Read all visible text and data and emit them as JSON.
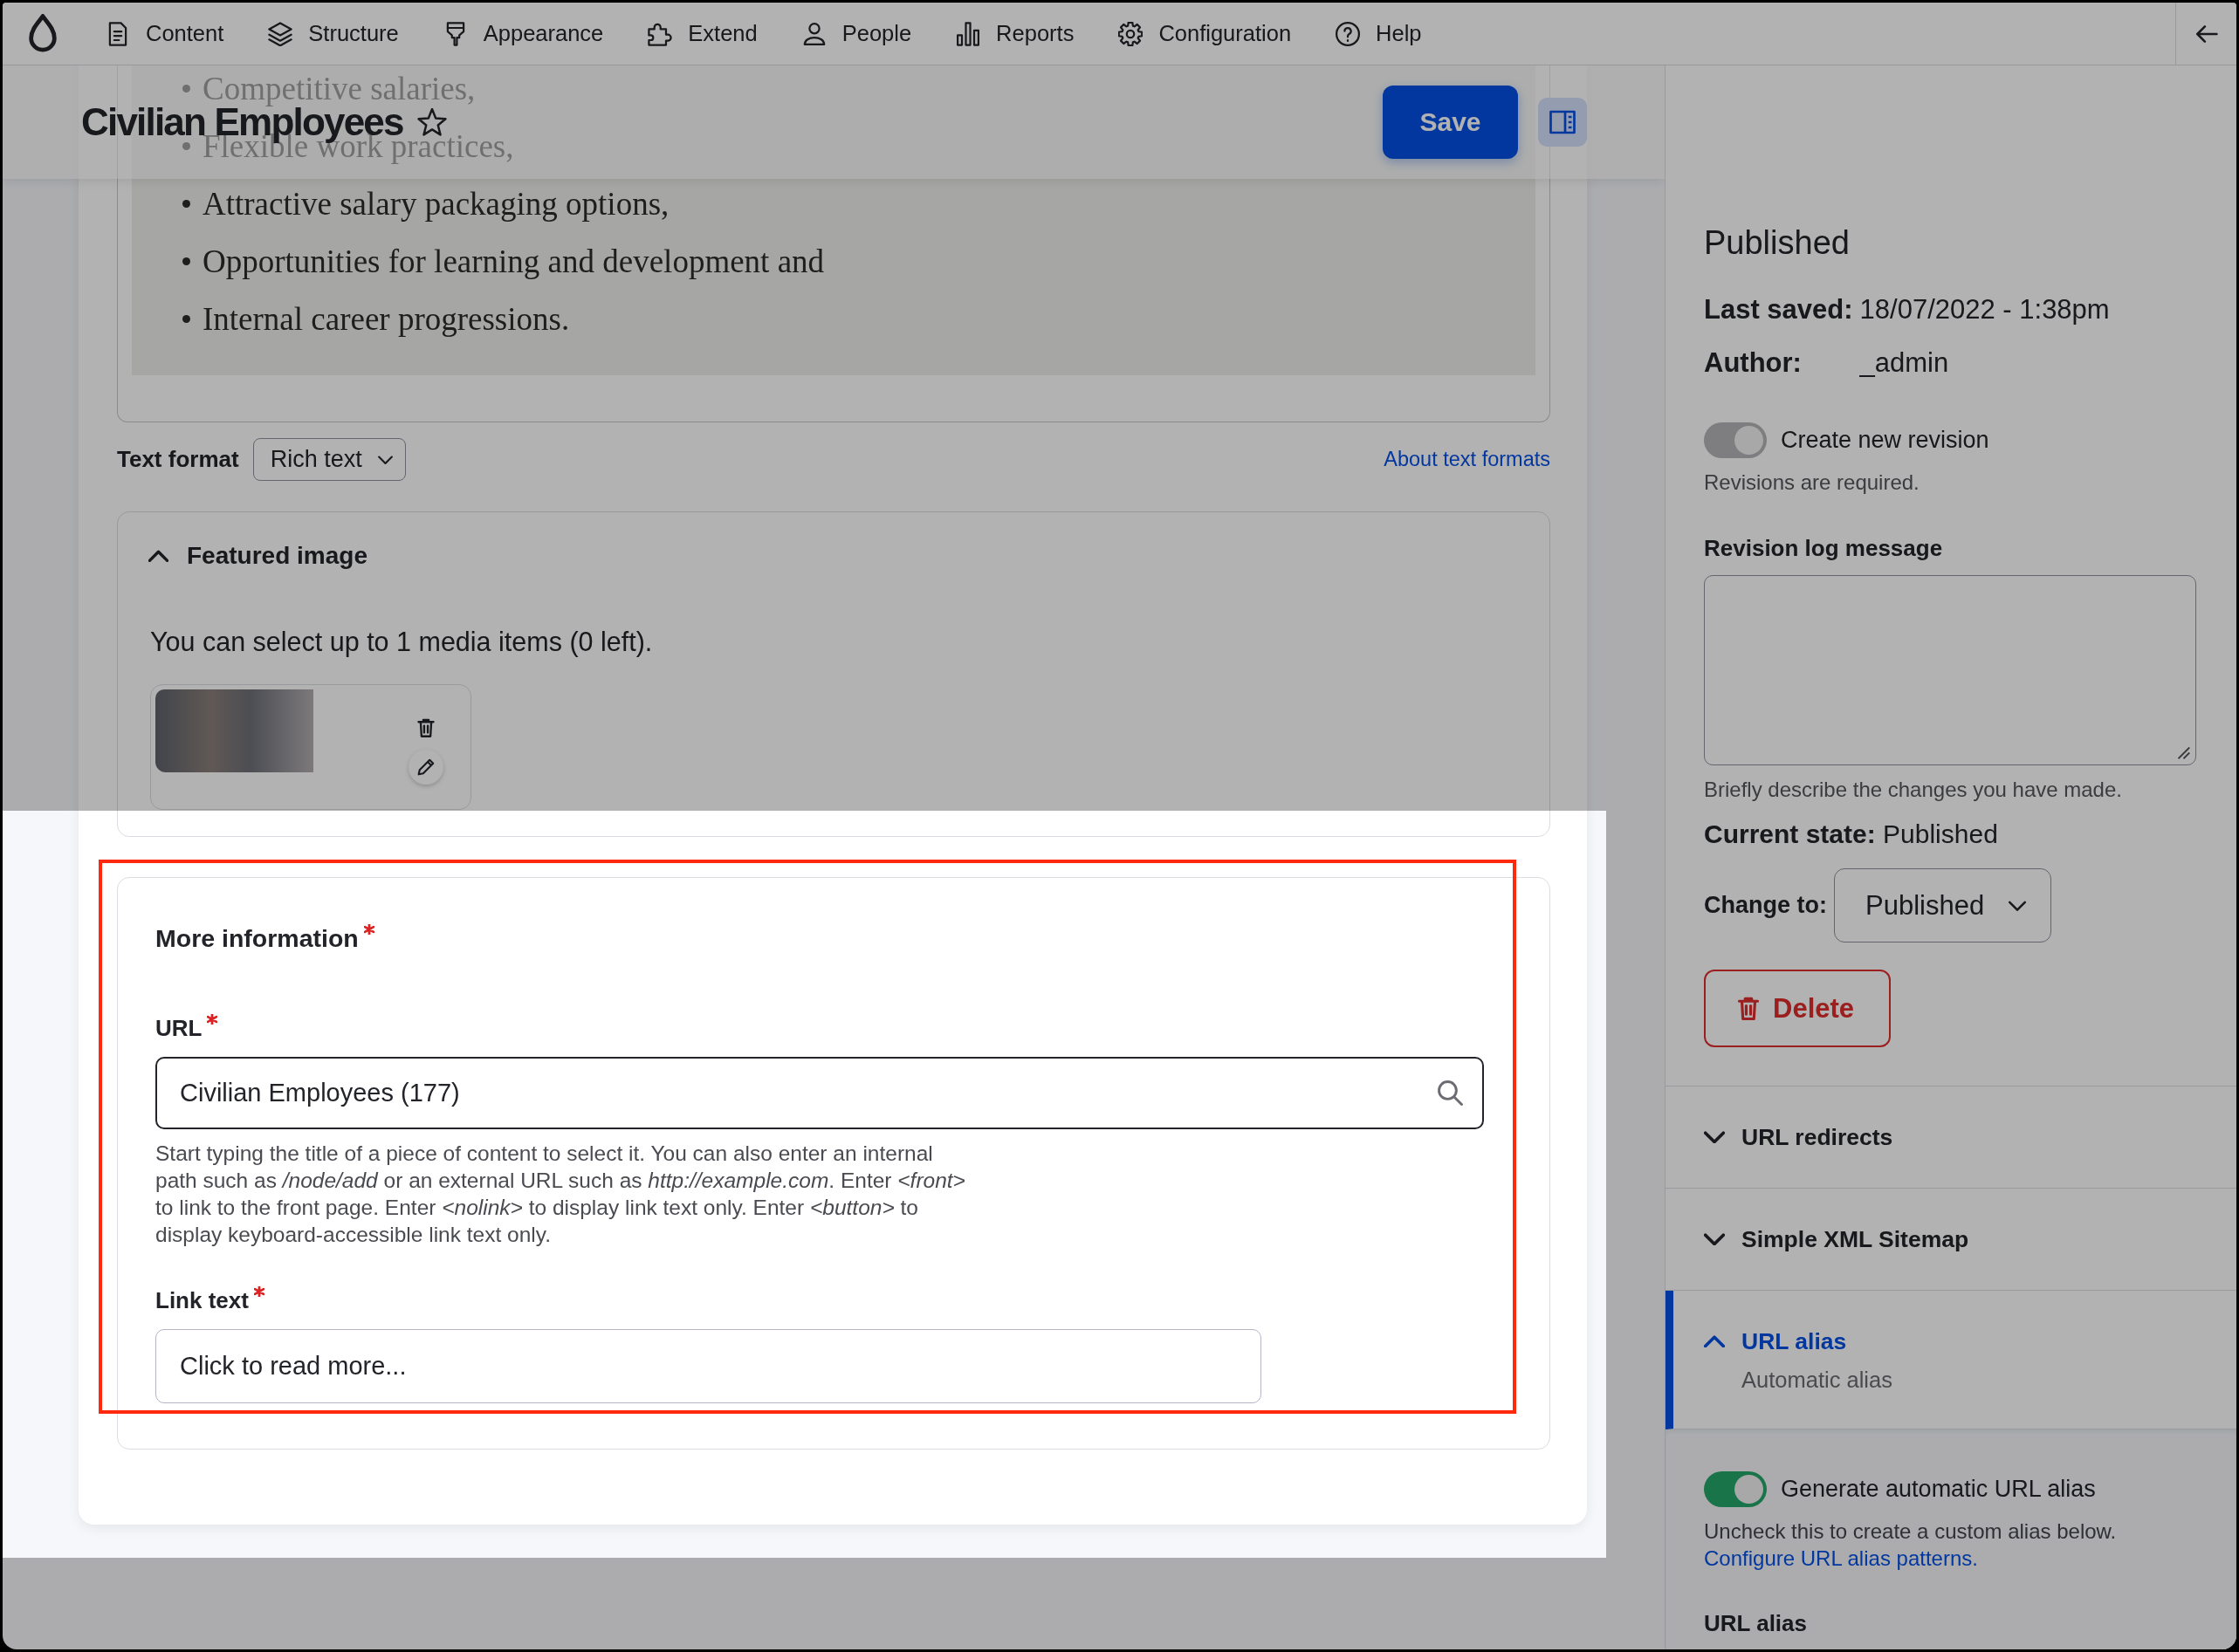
{
  "toolbar": {
    "items": [
      {
        "label": "Content"
      },
      {
        "label": "Structure"
      },
      {
        "label": "Appearance"
      },
      {
        "label": "Extend"
      },
      {
        "label": "People"
      },
      {
        "label": "Reports"
      },
      {
        "label": "Configuration"
      },
      {
        "label": "Help"
      }
    ]
  },
  "header": {
    "title": "Civilian Employees",
    "starred": false,
    "save_button": "Save"
  },
  "editor": {
    "items": [
      "Competitive salaries,",
      "Flexible work practices,",
      "Attractive salary packaging options,",
      "Opportunities for learning and development and",
      "Internal career progressions."
    ],
    "text_format": {
      "label": "Text format",
      "value": "Rich text"
    },
    "help_link": "About text formats"
  },
  "featured_image": {
    "title": "Featured image",
    "expanded": true,
    "note": "You can select up to 1 media items (0 left)."
  },
  "more_information": {
    "title": "More information",
    "required": true,
    "fields": [
      {
        "kind": "autocomplete",
        "label": "URL",
        "required": true,
        "focused": true,
        "value": "Civilian Employees (177)",
        "description": "Start typing the title of a piece of content to select it. You can also enter an internal path such as */node/add* or an external URL such as *http://example.com*. Enter *<front>* to link to the front page. Enter *<nolink>* to display link text only. Enter *<button>* to display keyboard-accessible link text only."
      },
      {
        "kind": "text",
        "label": "Link text",
        "required": true,
        "focused": false,
        "value": "Click to read more..."
      }
    ]
  },
  "sidebar": {
    "status": "Published",
    "meta": [
      {
        "label": "Last saved:",
        "value": "18/07/2022 - 1:38pm"
      },
      {
        "label": "Author:",
        "value": "_admin"
      }
    ],
    "revision": {
      "label": "Create new revision",
      "on": true,
      "disabled": true,
      "note": "Revisions are required."
    },
    "log": {
      "label": "Revision log message",
      "description": "Briefly describe the changes you have made."
    },
    "current_state": {
      "label": "Current state:",
      "value": "Published"
    },
    "change_to": {
      "label": "Change to:",
      "value": "Published"
    },
    "delete_button": "Delete",
    "sections": [
      {
        "title": "URL redirects",
        "expanded": false
      },
      {
        "title": "Simple XML Sitemap",
        "expanded": false
      },
      {
        "title": "URL alias",
        "expanded": true,
        "summary": "Automatic alias"
      }
    ],
    "url_alias": {
      "toggle": {
        "label": "Generate automatic URL alias",
        "on": true,
        "disabled": false
      },
      "description": "Uncheck this to create a custom alias below.",
      "link": "Configure URL alias patterns.",
      "field_label": "URL alias"
    }
  },
  "highlight": {
    "dimmed": true,
    "outlined": true
  }
}
